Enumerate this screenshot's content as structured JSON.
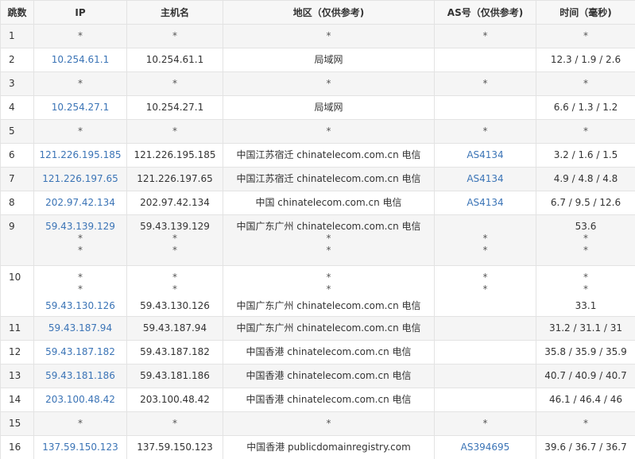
{
  "headers": {
    "hop": "跳数",
    "ip": "IP",
    "host": "主机名",
    "region": "地区（仅供参考)",
    "as": "AS号（仅供参考)",
    "time": "时间（毫秒)"
  },
  "rows": [
    {
      "hop": "1",
      "ip": "*",
      "host": "*",
      "region": "*",
      "as": "*",
      "time": "*"
    },
    {
      "hop": "2",
      "ip": "10.254.61.1",
      "host": "10.254.61.1",
      "region": "局域网",
      "as": "",
      "time": "12.3 / 1.9 / 2.6"
    },
    {
      "hop": "3",
      "ip": "*",
      "host": "*",
      "region": "*",
      "as": "*",
      "time": "*"
    },
    {
      "hop": "4",
      "ip": "10.254.27.1",
      "host": "10.254.27.1",
      "region": "局域网",
      "as": "",
      "time": "6.6 / 1.3 / 1.2"
    },
    {
      "hop": "5",
      "ip": "*",
      "host": "*",
      "region": "*",
      "as": "*",
      "time": "*"
    },
    {
      "hop": "6",
      "ip": "121.226.195.185",
      "host": "121.226.195.185",
      "region": "中国江苏宿迁 chinatelecom.com.cn 电信",
      "as": "AS4134",
      "time": "3.2 / 1.6 / 1.5"
    },
    {
      "hop": "7",
      "ip": "121.226.197.65",
      "host": "121.226.197.65",
      "region": "中国江苏宿迁 chinatelecom.com.cn 电信",
      "as": "AS4134",
      "time": "4.9 / 4.8 / 4.8"
    },
    {
      "hop": "8",
      "ip": "202.97.42.134",
      "host": "202.97.42.134",
      "region": "中国 chinatelecom.com.cn 电信",
      "as": "AS4134",
      "time": "6.7 / 9.5 / 12.6"
    },
    {
      "hop": "9",
      "ip": [
        "59.43.139.129",
        "*",
        "*"
      ],
      "host": [
        "59.43.139.129",
        "*",
        "*"
      ],
      "region": [
        "中国广东广州 chinatelecom.com.cn 电信",
        "*",
        "*"
      ],
      "as": [
        "",
        "*",
        "*"
      ],
      "time": [
        "53.6",
        "*",
        "*"
      ]
    },
    {
      "hop": "10",
      "ip": [
        "*",
        "*",
        "59.43.130.126"
      ],
      "host": [
        "*",
        "*",
        "59.43.130.126"
      ],
      "region": [
        "*",
        "*",
        "中国广东广州 chinatelecom.com.cn 电信"
      ],
      "as": [
        "*",
        "*",
        ""
      ],
      "time": [
        "*",
        "*",
        "33.1"
      ]
    },
    {
      "hop": "11",
      "ip": "59.43.187.94",
      "host": "59.43.187.94",
      "region": "中国广东广州 chinatelecom.com.cn 电信",
      "as": "",
      "time": "31.2 / 31.1 / 31"
    },
    {
      "hop": "12",
      "ip": "59.43.187.182",
      "host": "59.43.187.182",
      "region": "中国香港 chinatelecom.com.cn 电信",
      "as": "",
      "time": "35.8 / 35.9 / 35.9"
    },
    {
      "hop": "13",
      "ip": "59.43.181.186",
      "host": "59.43.181.186",
      "region": "中国香港 chinatelecom.com.cn 电信",
      "as": "",
      "time": "40.7 / 40.9 / 40.7"
    },
    {
      "hop": "14",
      "ip": "203.100.48.42",
      "host": "203.100.48.42",
      "region": "中国香港 chinatelecom.com.cn 电信",
      "as": "",
      "time": "46.1 / 46.4 / 46"
    },
    {
      "hop": "15",
      "ip": "*",
      "host": "*",
      "region": "*",
      "as": "*",
      "time": "*"
    },
    {
      "hop": "16",
      "ip": "137.59.150.123",
      "host": "137.59.150.123",
      "region": "中国香港 publicdomainregistry.com",
      "as": "AS394695",
      "time": "39.6 / 36.7 / 36.7"
    }
  ],
  "colors": {
    "link": "#3b74b6",
    "header_bg": "#f7f7f7",
    "stripe_bg": "#f5f5f5",
    "border": "#e3e3e3"
  }
}
